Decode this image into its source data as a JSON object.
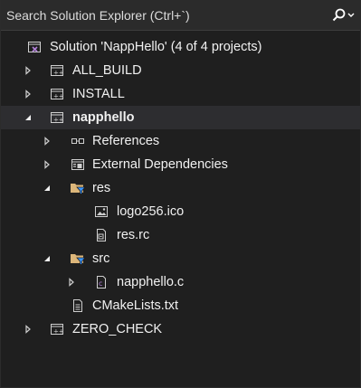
{
  "search": {
    "placeholder": "Search Solution Explorer (Ctrl+`)"
  },
  "tree": {
    "solution": "Solution 'NappHello' (4 of 4 projects)",
    "all_build": "ALL_BUILD",
    "install": "INSTALL",
    "napphello": "napphello",
    "references": "References",
    "external_deps": "External Dependencies",
    "res": "res",
    "logo": "logo256.ico",
    "res_rc": "res.rc",
    "src": "src",
    "napphello_c": "napphello.c",
    "cmakelists": "CMakeLists.txt",
    "zero_check": "ZERO_CHECK"
  },
  "colors": {
    "background": "#1f1f1f",
    "search_background": "#2b2b2b",
    "text": "#f1f1f1",
    "folder_yellow": "#dcb67a",
    "filter_blue": "#3794ff",
    "project_purple": "#b180d7"
  }
}
